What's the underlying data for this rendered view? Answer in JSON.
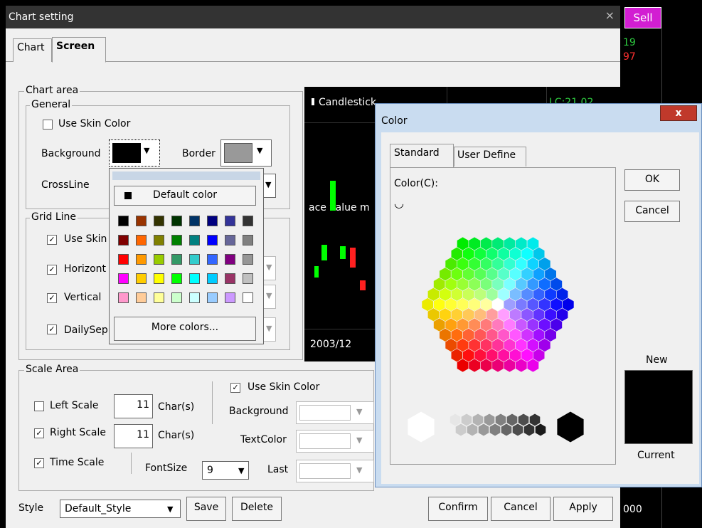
{
  "side": {
    "sell_label": "Sell",
    "v1": "19",
    "v2": "97",
    "v3": "000"
  },
  "window": {
    "title": "Chart setting",
    "close": "×"
  },
  "tabs": [
    {
      "label": "Chart"
    },
    {
      "label": "Screen"
    }
  ],
  "chart_area": {
    "legend": "Chart area",
    "general": {
      "legend": "General",
      "use_skin_color": "Use Skin Color",
      "background_label": "Background",
      "border_label": "Border",
      "crossline_label": "CrossLine"
    },
    "grid_line": {
      "legend": "Grid Line",
      "use_skin": "Use Skin",
      "horizontal": "Horizont",
      "vertical": "Vertical",
      "dailysep": "DailySep"
    }
  },
  "color_popup": {
    "default_label": "Default color",
    "more_label": "More colors...",
    "swatches": [
      [
        "#000000",
        "#993300",
        "#333300",
        "#003300",
        "#003366",
        "#000080",
        "#333399",
        "#333333"
      ],
      [
        "#800000",
        "#ff6600",
        "#808000",
        "#008000",
        "#008080",
        "#0000ff",
        "#666699",
        "#808080"
      ],
      [
        "#ff0000",
        "#ff9900",
        "#99cc00",
        "#339966",
        "#33cccc",
        "#3366ff",
        "#800080",
        "#969696"
      ],
      [
        "#ff00ff",
        "#ffcc00",
        "#ffff00",
        "#00ff00",
        "#00ffff",
        "#00ccff",
        "#993366",
        "#c0c0c0"
      ],
      [
        "#ff99cc",
        "#ffcc99",
        "#ffff99",
        "#ccffcc",
        "#ccffff",
        "#99ccff",
        "#cc99ff",
        "#ffffff"
      ]
    ]
  },
  "preview": {
    "title": "Candlestick",
    "lc": "LC:21.02",
    "face": "ace value m",
    "date": "2003/12"
  },
  "scale_area": {
    "legend": "Scale Area",
    "left_scale": "Left Scale",
    "left_value": "11",
    "right_scale": "Right Scale",
    "right_value": "11",
    "time_scale": "Time Scale",
    "chars": "Char(s)",
    "fontsize_label": "FontSize",
    "fontsize_value": "9",
    "use_skin_color": "Use Skin Color",
    "background_label": "Background",
    "textcolor_label": "TextColor",
    "last_label": "Last"
  },
  "footer": {
    "style_label": "Style",
    "style_value": "Default_Style",
    "save": "Save",
    "delete": "Delete",
    "confirm": "Confirm",
    "cancel": "Cancel",
    "apply": "Apply"
  },
  "color_dialog": {
    "title": "Color",
    "close": "x",
    "tab_standard": "Standard",
    "tab_user": "User Define",
    "color_label": "Color(C):",
    "ok": "OK",
    "cancel": "Cancel",
    "new_label": "New",
    "current_label": "Current",
    "new_color": "#000000"
  }
}
